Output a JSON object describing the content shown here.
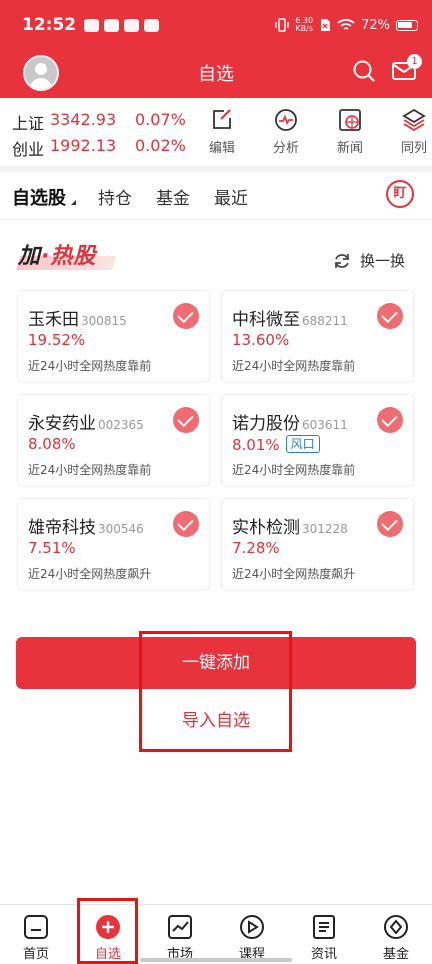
{
  "status_bar": {
    "time": "12:52",
    "speed_top": "6.30",
    "speed_bottom": "KB/s",
    "battery": "72%"
  },
  "header": {
    "title": "自选",
    "mail_badge": "1"
  },
  "indices": [
    {
      "name": "上证",
      "value": "3342.93",
      "pct": "0.07%"
    },
    {
      "name": "创业",
      "value": "1992.13",
      "pct": "0.02%"
    }
  ],
  "tools": [
    {
      "label": "编辑"
    },
    {
      "label": "分析"
    },
    {
      "label": "新闻"
    },
    {
      "label": "同列"
    }
  ],
  "tabs": [
    {
      "label": "自选股"
    },
    {
      "label": "持仓"
    },
    {
      "label": "基金"
    },
    {
      "label": "最近"
    }
  ],
  "tab_right_icon": "盯",
  "hot_section": {
    "title_first": "加",
    "title_dot": "·",
    "title_rest": "热股",
    "refresh_label": "换一换"
  },
  "stocks": [
    {
      "name": "玉禾田",
      "code": "300815",
      "pct": "19.52%",
      "tag": "",
      "desc": "近24小时全网热度靠前"
    },
    {
      "name": "中科微至",
      "code": "688211",
      "pct": "13.60%",
      "tag": "",
      "desc": "近24小时全网热度靠前"
    },
    {
      "name": "永安药业",
      "code": "002365",
      "pct": "8.08%",
      "tag": "",
      "desc": "近24小时全网热度靠前"
    },
    {
      "name": "诺力股份",
      "code": "603611",
      "pct": "8.01%",
      "tag": "风口",
      "desc": "近24小时全网热度靠前"
    },
    {
      "name": "雄帝科技",
      "code": "300546",
      "pct": "7.51%",
      "tag": "",
      "desc": "近24小时全网热度飙升"
    },
    {
      "name": "实朴检测",
      "code": "301228",
      "pct": "7.28%",
      "tag": "",
      "desc": "近24小时全网热度飙升"
    }
  ],
  "actions": {
    "add_all": "一键添加",
    "import": "导入自选"
  },
  "bottom_nav": [
    {
      "label": "首页"
    },
    {
      "label": "自选"
    },
    {
      "label": "市场"
    },
    {
      "label": "课程"
    },
    {
      "label": "资讯"
    },
    {
      "label": "基金"
    }
  ],
  "colors": {
    "brand_red": "#e8323c",
    "up_red": "#e0333c",
    "tag_blue": "#2a7bd6"
  }
}
